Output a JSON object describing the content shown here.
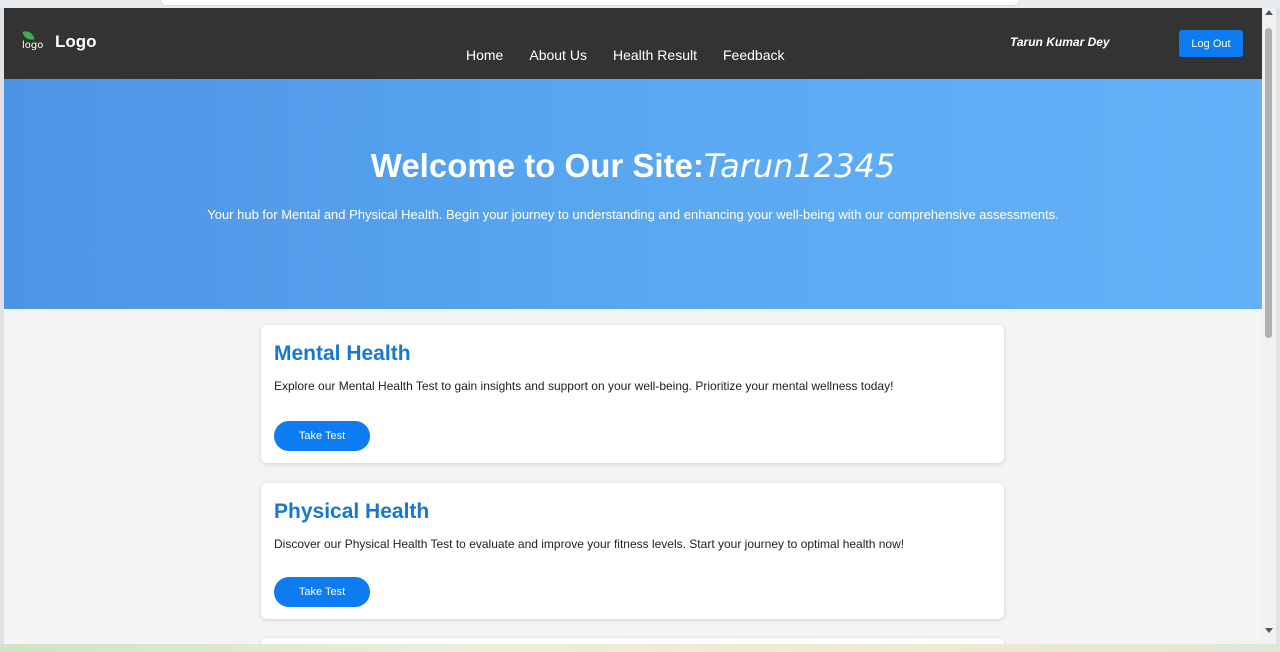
{
  "navbar": {
    "logo_alt": "logo",
    "logo_text": "Logo",
    "links": [
      "Home",
      "About Us",
      "Health Result",
      "Feedback"
    ],
    "user_name": "Tarun Kumar Dey",
    "logout_label": "Log Out"
  },
  "hero": {
    "title_prefix": "Welcome to Our Site:",
    "username": "Tarun12345",
    "subtitle": "Your hub for Mental and Physical Health. Begin your journey to understanding and enhancing your well-being with our comprehensive assessments."
  },
  "cards": [
    {
      "title": "Mental Health",
      "description": "Explore our Mental Health Test to gain insights and support on your well-being. Prioritize your mental wellness today!",
      "button_label": "Take Test"
    },
    {
      "title": "Physical Health",
      "description": "Discover our Physical Health Test to evaluate and improve your fitness levels. Start your journey to optimal health now!",
      "button_label": "Take Test"
    }
  ],
  "colors": {
    "navbar_bg": "#333333",
    "accent": "#0d7cf2",
    "card_title": "#1876d1",
    "hero_gradient_start": "#4d94e6",
    "hero_gradient_end": "#64b1f8"
  }
}
